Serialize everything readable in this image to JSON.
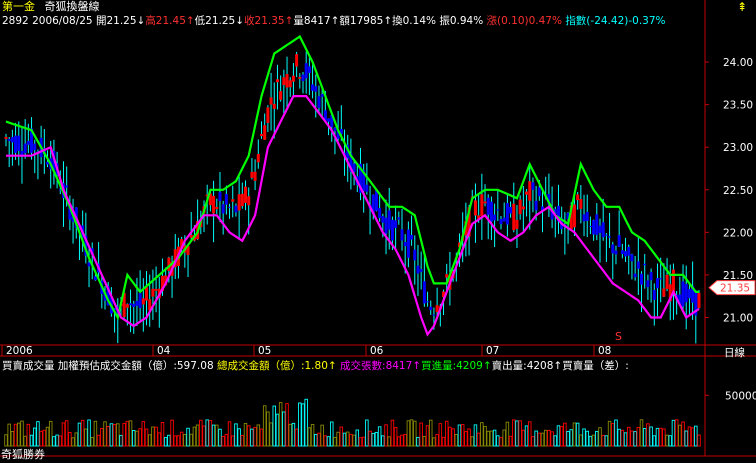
{
  "header": {
    "stock_name": "第一金",
    "chart_name": "奇狐換盤線",
    "pin_icon": "pin-icon"
  },
  "info": {
    "code": "2892",
    "date": "2006/08/25",
    "open": "開21.25↓",
    "high": "高21.45↑",
    "low": "低21.25↓",
    "close": "收21.35↑",
    "volume": "量8417↑",
    "amount": "額17985↑",
    "turnover": "換0.14%",
    "amplitude": "振0.94%",
    "change": "漲(0.10)0.47%",
    "index": "指數(-24.42)-0.37%"
  },
  "indicator": {
    "title": "買賣成交量",
    "est_amount": "加權預估成交金額（億）:597.08",
    "total_amount": "總成交金額（億）:1.80↑",
    "deal_volume": "成交張數:8417↑",
    "buy_volume": "買進量:4209↑",
    "sell_volume": "賣出量:4208↑",
    "diff": "買賣量（差）:"
  },
  "footer": {
    "watermark": "奇狐勝券",
    "period_label": "日線"
  },
  "colors": {
    "up_candle": "#ff0000",
    "down_candle": "#0000ff",
    "wick": "#00ffff",
    "upper_line": "#00ff00",
    "lower_line": "#ff00ff",
    "price_tag": "#ff4040",
    "axis": "#c00000",
    "vol_up": "#ff0000",
    "vol_down": "#00ffff",
    "vol_other": "#888800"
  },
  "chart_data": {
    "type": "candlestick",
    "y_ticks": [
      21.0,
      21.5,
      22.0,
      22.5,
      23.0,
      23.5,
      24.0
    ],
    "ylim": [
      20.7,
      24.4
    ],
    "x_labels": [
      "2006",
      "04",
      "05",
      "06",
      "07",
      "08"
    ],
    "last_price": "21.35",
    "volume_axis_label": "50000",
    "volume_ylim": [
      0,
      70000
    ],
    "marker": "S",
    "upper_line": [
      [
        0,
        23.3
      ],
      [
        8,
        23.2
      ],
      [
        14,
        22.8
      ],
      [
        20,
        22.3
      ],
      [
        26,
        21.7
      ],
      [
        32,
        21.2
      ],
      [
        35,
        21.0
      ],
      [
        38,
        21.5
      ],
      [
        42,
        21.3
      ],
      [
        48,
        21.5
      ],
      [
        54,
        21.7
      ],
      [
        60,
        22.0
      ],
      [
        64,
        22.5
      ],
      [
        68,
        22.5
      ],
      [
        72,
        22.6
      ],
      [
        76,
        22.9
      ],
      [
        80,
        23.6
      ],
      [
        84,
        24.1
      ],
      [
        88,
        24.2
      ],
      [
        92,
        24.3
      ],
      [
        96,
        24.0
      ],
      [
        100,
        23.6
      ],
      [
        104,
        23.2
      ],
      [
        108,
        22.9
      ],
      [
        112,
        22.7
      ],
      [
        116,
        22.5
      ],
      [
        120,
        22.3
      ],
      [
        124,
        22.3
      ],
      [
        128,
        22.2
      ],
      [
        132,
        21.6
      ],
      [
        134,
        21.4
      ],
      [
        138,
        21.4
      ],
      [
        142,
        21.8
      ],
      [
        146,
        22.4
      ],
      [
        150,
        22.5
      ],
      [
        154,
        22.5
      ],
      [
        160,
        22.4
      ],
      [
        164,
        22.8
      ],
      [
        168,
        22.5
      ],
      [
        172,
        22.2
      ],
      [
        176,
        22.1
      ],
      [
        180,
        22.8
      ],
      [
        184,
        22.5
      ],
      [
        188,
        22.3
      ],
      [
        192,
        22.3
      ],
      [
        196,
        22.0
      ],
      [
        200,
        21.9
      ],
      [
        204,
        21.7
      ],
      [
        208,
        21.5
      ],
      [
        212,
        21.5
      ],
      [
        216,
        21.3
      ]
    ],
    "lower_line": [
      [
        0,
        22.9
      ],
      [
        8,
        22.9
      ],
      [
        14,
        23.0
      ],
      [
        18,
        22.5
      ],
      [
        24,
        22.0
      ],
      [
        30,
        21.5
      ],
      [
        36,
        21.0
      ],
      [
        40,
        20.9
      ],
      [
        44,
        21.0
      ],
      [
        50,
        21.4
      ],
      [
        56,
        21.9
      ],
      [
        62,
        22.2
      ],
      [
        66,
        22.2
      ],
      [
        70,
        22.0
      ],
      [
        74,
        21.9
      ],
      [
        78,
        22.2
      ],
      [
        82,
        23.0
      ],
      [
        86,
        23.3
      ],
      [
        90,
        23.6
      ],
      [
        94,
        23.6
      ],
      [
        98,
        23.4
      ],
      [
        102,
        23.2
      ],
      [
        106,
        22.9
      ],
      [
        110,
        22.6
      ],
      [
        114,
        22.3
      ],
      [
        118,
        22.0
      ],
      [
        122,
        21.8
      ],
      [
        126,
        21.5
      ],
      [
        130,
        21.0
      ],
      [
        132,
        20.8
      ],
      [
        134,
        20.9
      ],
      [
        138,
        21.3
      ],
      [
        142,
        21.7
      ],
      [
        146,
        22.1
      ],
      [
        150,
        22.2
      ],
      [
        154,
        22.0
      ],
      [
        158,
        21.9
      ],
      [
        162,
        22.0
      ],
      [
        166,
        22.2
      ],
      [
        170,
        22.3
      ],
      [
        174,
        22.1
      ],
      [
        178,
        22.0
      ],
      [
        182,
        21.8
      ],
      [
        186,
        21.6
      ],
      [
        190,
        21.4
      ],
      [
        194,
        21.3
      ],
      [
        198,
        21.2
      ],
      [
        202,
        21.0
      ],
      [
        205,
        21.0
      ],
      [
        209,
        21.3
      ],
      [
        213,
        21.0
      ],
      [
        217,
        21.1
      ]
    ]
  }
}
